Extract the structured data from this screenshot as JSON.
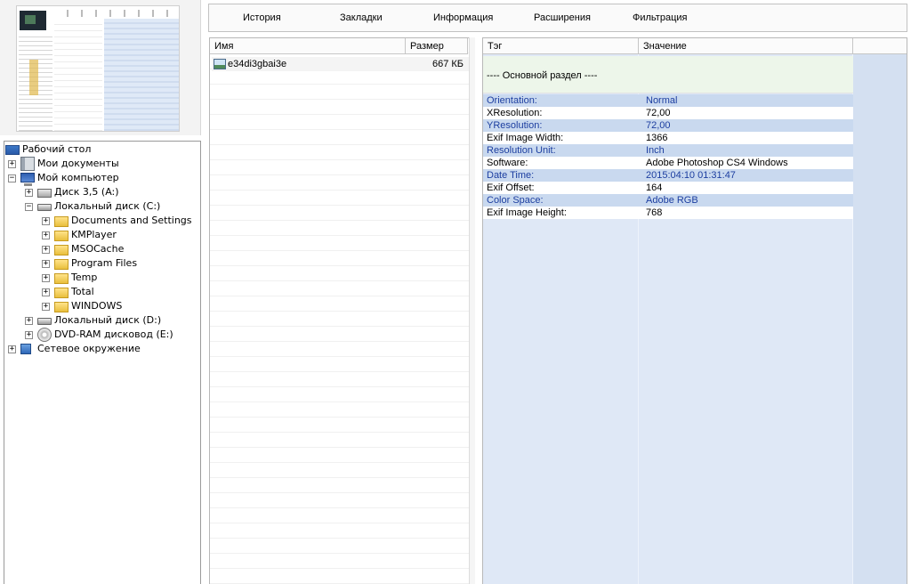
{
  "menu": [
    "История",
    "Закладки",
    "Информация",
    "Расширения",
    "Фильтрация"
  ],
  "tree": [
    {
      "label": "Рабочий стол",
      "icon": "desktop-icon",
      "depth": 0,
      "expander": ""
    },
    {
      "label": "Мои документы",
      "icon": "documents-icon",
      "depth": 1,
      "expander": "+"
    },
    {
      "label": "Мой компьютер",
      "icon": "computer-icon",
      "depth": 1,
      "expander": "−"
    },
    {
      "label": "Диск 3,5 (A:)",
      "icon": "floppy-icon",
      "depth": 2,
      "expander": "+"
    },
    {
      "label": "Локальный диск (C:)",
      "icon": "drive-icon",
      "depth": 2,
      "expander": "−"
    },
    {
      "label": "Documents and Settings",
      "icon": "folder-icon",
      "depth": 3,
      "expander": "+"
    },
    {
      "label": "KMPlayer",
      "icon": "folder-icon",
      "depth": 3,
      "expander": "+"
    },
    {
      "label": "MSOCache",
      "icon": "folder-icon",
      "depth": 3,
      "expander": "+"
    },
    {
      "label": "Program Files",
      "icon": "folder-icon",
      "depth": 3,
      "expander": "+"
    },
    {
      "label": "Temp",
      "icon": "folder-icon",
      "depth": 3,
      "expander": "+"
    },
    {
      "label": "Total",
      "icon": "folder-icon",
      "depth": 3,
      "expander": "+"
    },
    {
      "label": "WINDOWS",
      "icon": "folder-icon",
      "depth": 3,
      "expander": "+"
    },
    {
      "label": "Локальный диск (D:)",
      "icon": "drive-icon",
      "depth": 2,
      "expander": "+"
    },
    {
      "label": "DVD-RAM дисковод (E:)",
      "icon": "dvd-icon",
      "depth": 2,
      "expander": "+"
    },
    {
      "label": "Сетевое окружение",
      "icon": "network-icon",
      "depth": 1,
      "expander": "+"
    }
  ],
  "files": {
    "headers": {
      "name": "Имя",
      "size": "Размер"
    },
    "items": [
      {
        "name": "e34di3gbai3e",
        "size": "667 КБ"
      }
    ]
  },
  "tags": {
    "headers": {
      "tag": "Тэг",
      "value": "Значение"
    },
    "section": "---- Основной раздел ----",
    "rows": [
      {
        "tag": "Orientation:",
        "value": "Normal"
      },
      {
        "tag": "XResolution:",
        "value": "72,00"
      },
      {
        "tag": "YResolution:",
        "value": "72,00"
      },
      {
        "tag": "Exif Image Width:",
        "value": "1366"
      },
      {
        "tag": "Resolution Unit:",
        "value": "Inch"
      },
      {
        "tag": "Software:",
        "value": "Adobe Photoshop CS4 Windows"
      },
      {
        "tag": "Date Time:",
        "value": "2015:04:10 01:31:47"
      },
      {
        "tag": "Exif Offset:",
        "value": "164"
      },
      {
        "tag": "Color Space:",
        "value": "Adobe RGB"
      },
      {
        "tag": "Exif Image Height:",
        "value": "768"
      }
    ]
  }
}
